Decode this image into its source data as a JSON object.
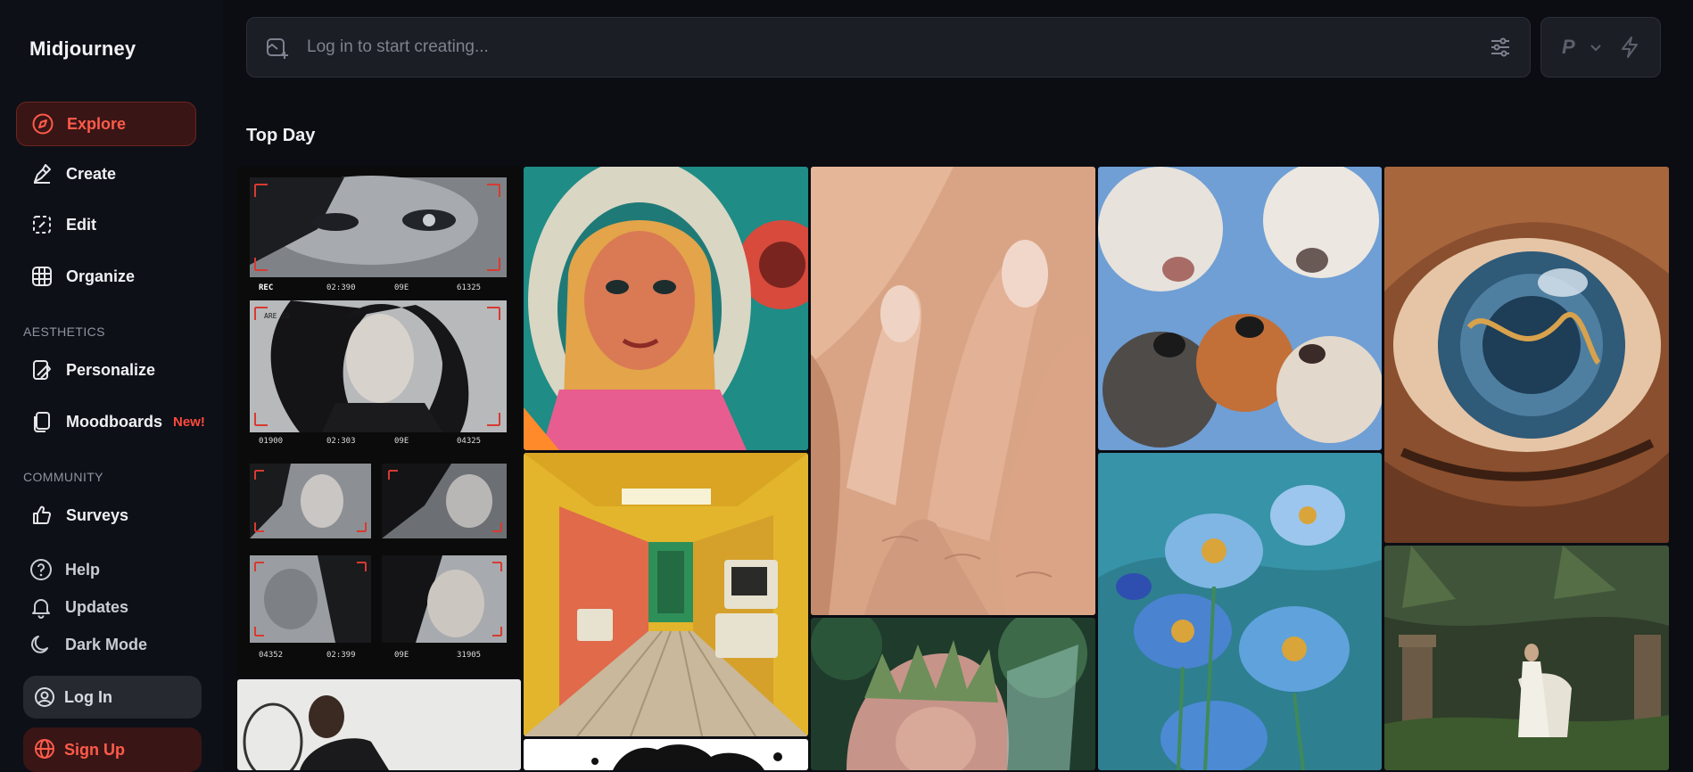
{
  "brand": "Midjourney",
  "nav": {
    "explore": "Explore",
    "create": "Create",
    "edit": "Edit",
    "organize": "Organize"
  },
  "aesthetics": {
    "label": "AESTHETICS",
    "personalize": "Personalize",
    "moodboards": "Moodboards",
    "moodboards_badge": "New!"
  },
  "community": {
    "label": "COMMUNITY",
    "surveys": "Surveys"
  },
  "footer_links": {
    "help": "Help",
    "updates": "Updates",
    "dark_mode": "Dark Mode"
  },
  "auth": {
    "login": "Log In",
    "signup": "Sign Up"
  },
  "prompt": {
    "placeholder": "Log in to start creating..."
  },
  "mode": {
    "letter": "P"
  },
  "section_title": "Top Day",
  "gallery": [
    {
      "name": "collage-film-frames",
      "caption_rec": "REC",
      "caption_time1": "02:390",
      "caption_09e": "09E",
      "caption_c1": "61325",
      "caption_are": "ARE ID",
      "caption_c2": "01900",
      "caption_t2": "02:303",
      "caption_c3": "04325",
      "caption_c4": "04352",
      "caption_t4": "02:399",
      "caption_c5": "31905"
    },
    {
      "name": "retro-doll-astronaut"
    },
    {
      "name": "hand-on-cheek-closeup"
    },
    {
      "name": "dogs-looking-down"
    },
    {
      "name": "eye-macro"
    },
    {
      "name": "yellow-retro-corridor"
    },
    {
      "name": "blue-poppies-painting"
    },
    {
      "name": "forest-fairy"
    },
    {
      "name": "jungle-horse-ruins"
    },
    {
      "name": "tennis-player"
    },
    {
      "name": "ink-splash"
    }
  ],
  "colors": {
    "accent": "#ff5b4a",
    "active_bg": "#3a1515",
    "background": "#0b0d13"
  }
}
